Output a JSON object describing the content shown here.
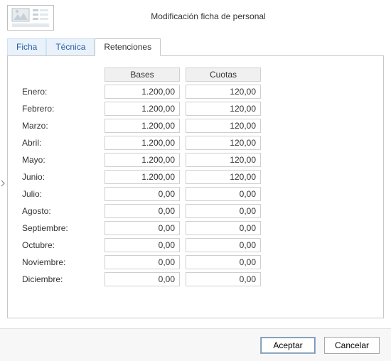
{
  "header": {
    "title": "Modificación ficha de personal"
  },
  "tabs": [
    {
      "label": "Ficha",
      "active": false
    },
    {
      "label": "Técnica",
      "active": false
    },
    {
      "label": "Retenciones",
      "active": true
    }
  ],
  "columns": {
    "bases": "Bases",
    "cuotas": "Cuotas"
  },
  "rows": [
    {
      "month": "Enero:",
      "bases": "1.200,00",
      "cuotas": "120,00"
    },
    {
      "month": "Febrero:",
      "bases": "1.200,00",
      "cuotas": "120,00"
    },
    {
      "month": "Marzo:",
      "bases": "1.200,00",
      "cuotas": "120,00"
    },
    {
      "month": "Abril:",
      "bases": "1.200,00",
      "cuotas": "120,00"
    },
    {
      "month": "Mayo:",
      "bases": "1.200,00",
      "cuotas": "120,00"
    },
    {
      "month": "Junio:",
      "bases": "1.200,00",
      "cuotas": "120,00"
    },
    {
      "month": "Julio:",
      "bases": "0,00",
      "cuotas": "0,00"
    },
    {
      "month": "Agosto:",
      "bases": "0,00",
      "cuotas": "0,00"
    },
    {
      "month": "Septiembre:",
      "bases": "0,00",
      "cuotas": "0,00"
    },
    {
      "month": "Octubre:",
      "bases": "0,00",
      "cuotas": "0,00"
    },
    {
      "month": "Noviembre:",
      "bases": "0,00",
      "cuotas": "0,00"
    },
    {
      "month": "Diciembre:",
      "bases": "0,00",
      "cuotas": "0,00"
    }
  ],
  "buttons": {
    "accept": "Aceptar",
    "cancel": "Cancelar"
  }
}
